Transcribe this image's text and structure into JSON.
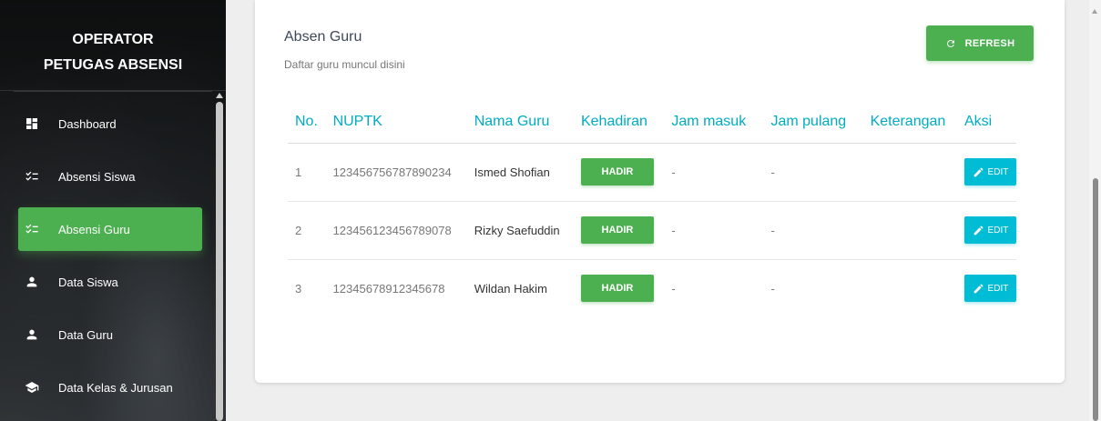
{
  "sidebar": {
    "brand_line1": "OPERATOR",
    "brand_line2": "PETUGAS ABSENSI",
    "items": [
      {
        "label": "Dashboard",
        "icon": "dashboard-icon",
        "active": false
      },
      {
        "label": "Absensi Siswa",
        "icon": "checklist-icon",
        "active": false
      },
      {
        "label": "Absensi Guru",
        "icon": "checklist-icon",
        "active": true
      },
      {
        "label": "Data Siswa",
        "icon": "person-icon",
        "active": false
      },
      {
        "label": "Data Guru",
        "icon": "person-icon",
        "active": false
      },
      {
        "label": "Data Kelas & Jurusan",
        "icon": "school-icon",
        "active": false
      }
    ]
  },
  "card": {
    "title": "Absen Guru",
    "subtitle": "Daftar guru muncul disini",
    "refresh_label": "REFRESH"
  },
  "table": {
    "headers": [
      "No.",
      "NUPTK",
      "Nama Guru",
      "Kehadiran",
      "Jam masuk",
      "Jam pulang",
      "Keterangan",
      "Aksi"
    ],
    "rows": [
      {
        "no": "1",
        "nuptk": "123456756787890234",
        "nama": "Ismed Shofian",
        "kehadiran": "HADIR",
        "jam_masuk": "-",
        "jam_pulang": "-",
        "keterangan": "",
        "aksi": "EDIT"
      },
      {
        "no": "2",
        "nuptk": "123456123456789078",
        "nama": "Rizky Saefuddin",
        "kehadiran": "HADIR",
        "jam_masuk": "-",
        "jam_pulang": "-",
        "keterangan": "",
        "aksi": "EDIT"
      },
      {
        "no": "3",
        "nuptk": "12345678912345678",
        "nama": "Wildan Hakim",
        "kehadiran": "HADIR",
        "jam_masuk": "-",
        "jam_pulang": "-",
        "keterangan": "",
        "aksi": "EDIT"
      }
    ]
  },
  "colors": {
    "accent_green": "#4caf50",
    "header_cyan": "#00acc1",
    "edit_cyan": "#00bcd4"
  }
}
